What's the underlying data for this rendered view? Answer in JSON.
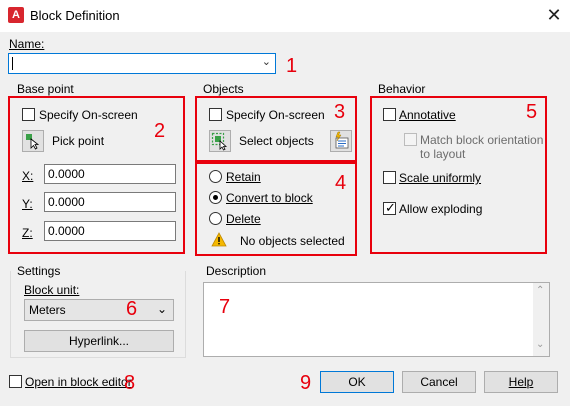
{
  "window": {
    "title": "Block Definition",
    "app_icon_letter": "A",
    "close_glyph": "✕"
  },
  "name": {
    "label": "Name:",
    "value": ""
  },
  "base_point": {
    "title": "Base point",
    "specify_onscreen": "Specify On-screen",
    "pick_point": "Pick point",
    "x_label": "X:",
    "x_value": "0.0000",
    "y_label": "Y:",
    "y_value": "0.0000",
    "z_label": "Z:",
    "z_value": "0.0000"
  },
  "objects": {
    "title": "Objects",
    "specify_onscreen": "Specify On-screen",
    "select_objects": "Select objects",
    "retain": "Retain",
    "convert_to_block": "Convert to block",
    "delete": "Delete",
    "status": "No objects selected",
    "selected_option": "convert_to_block"
  },
  "behavior": {
    "title": "Behavior",
    "annotative": "Annotative",
    "match_orientation_line1": "Match block orientation",
    "match_orientation_line2": "to layout",
    "scale_uniformly": "Scale uniformly",
    "allow_exploding": "Allow exploding",
    "allow_exploding_checked": true
  },
  "settings": {
    "title": "Settings",
    "block_unit_label": "Block unit:",
    "block_unit_value": "Meters",
    "hyperlink": "Hyperlink..."
  },
  "description": {
    "title": "Description",
    "value": ""
  },
  "footer": {
    "open_in_editor": "Open in block editor",
    "ok": "OK",
    "cancel": "Cancel",
    "help": "Help"
  },
  "callouts": [
    "1",
    "2",
    "3",
    "4",
    "5",
    "6",
    "7",
    "8",
    "9"
  ],
  "colors": {
    "callout_red": "#e8000d",
    "accent_blue": "#0078d7",
    "app_red": "#d8262e"
  },
  "icons": {
    "pick_point": "pick-point-icon",
    "select_objects": "select-objects-icon",
    "quick_select": "quick-select-icon",
    "warning": "warning-icon"
  }
}
